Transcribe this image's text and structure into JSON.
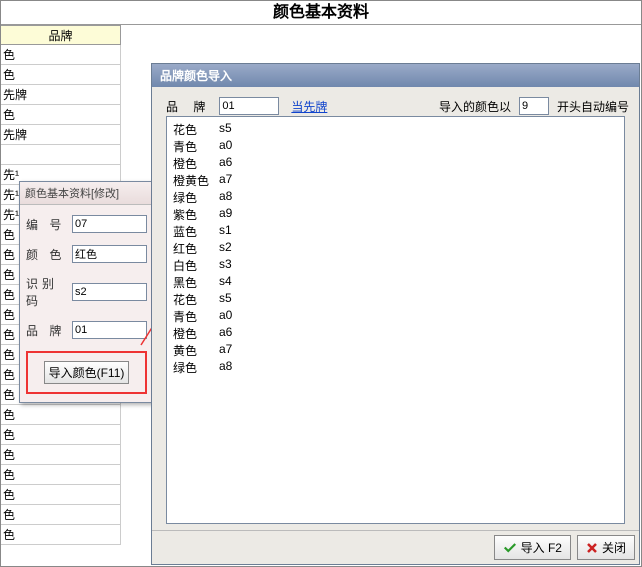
{
  "main": {
    "title": "颜色基本资料"
  },
  "left": {
    "brand_header": "品牌",
    "rows": [
      "色",
      "色",
      "先牌",
      "色",
      "先牌",
      "",
      "先¹",
      "先¹",
      "先¹",
      "色",
      "色",
      "色",
      "色",
      "色",
      "色",
      "色",
      "色",
      "色",
      "色",
      "色",
      "色",
      "色",
      "色",
      "色",
      "色"
    ]
  },
  "mod": {
    "title": "颜色基本资料[修改]",
    "fields": {
      "id_label": "编 号",
      "id_value": "07",
      "color_label": "颜 色",
      "color_value": "红色",
      "code_label": "识别码",
      "code_value": "s2",
      "brand_label": "品 牌",
      "brand_value": "01"
    },
    "import_btn": "导入颜色(F11)"
  },
  "imp": {
    "title": "品牌颜色导入",
    "brand_label": "品  牌",
    "brand_value": "01",
    "cur_brand_link": "当先牌",
    "prefix_label": "导入的颜色以",
    "prefix_value": "9",
    "prefix_suffix": "开头自动编号",
    "list": [
      {
        "name": "花色",
        "code": "s5"
      },
      {
        "name": "青色",
        "code": "a0"
      },
      {
        "name": "橙色",
        "code": "a6"
      },
      {
        "name": "橙黄色",
        "code": "a7"
      },
      {
        "name": "绿色",
        "code": "a8"
      },
      {
        "name": "紫色",
        "code": "a9"
      },
      {
        "name": "蓝色",
        "code": "s1"
      },
      {
        "name": "红色",
        "code": "s2"
      },
      {
        "name": "白色",
        "code": "s3"
      },
      {
        "name": "黑色",
        "code": "s4"
      },
      {
        "name": "花色",
        "code": "s5"
      },
      {
        "name": "青色",
        "code": "a0"
      },
      {
        "name": "橙色",
        "code": "a6"
      },
      {
        "name": "黄色",
        "code": "a7"
      },
      {
        "name": "绿色",
        "code": "a8"
      }
    ],
    "import_label": "导入 F2",
    "close_label": "关闭"
  }
}
